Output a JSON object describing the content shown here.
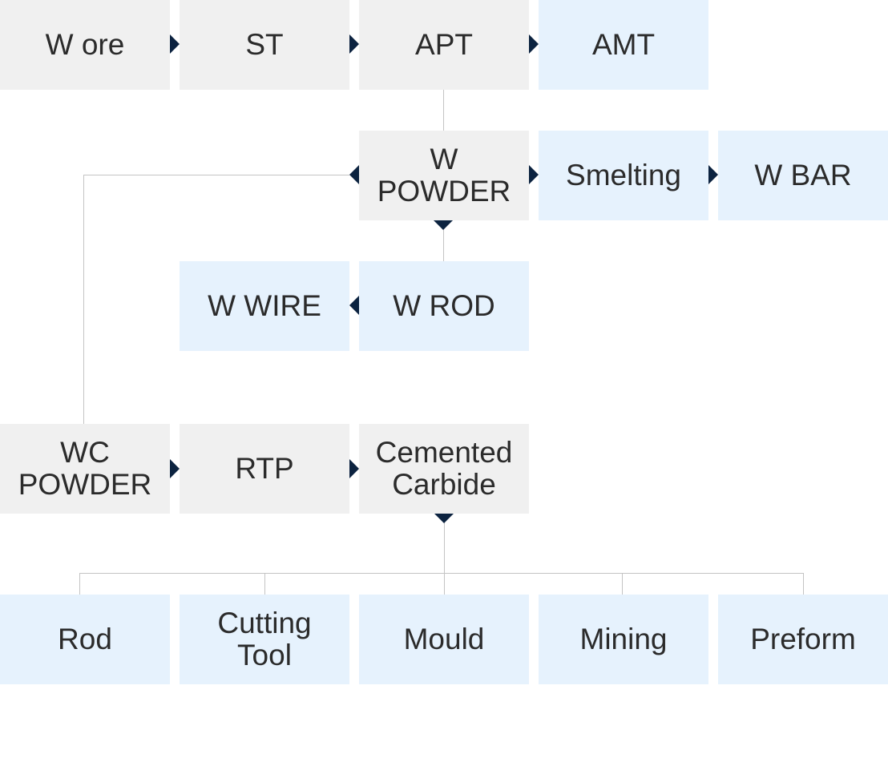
{
  "colors": {
    "process": "#f0f0f0",
    "product": "#e6f2fd",
    "arrow": "#0c2340",
    "line": "#c4c4c4"
  },
  "nodes": {
    "w_ore": "W ore",
    "st": "ST",
    "apt": "APT",
    "amt": "AMT",
    "w_powder": "W\nPOWDER",
    "smelting": "Smelting",
    "w_bar": "W BAR",
    "w_wire": "W WIRE",
    "w_rod": "W ROD",
    "wc_powder": "WC\nPOWDER",
    "rtp": "RTP",
    "cemented_carbide": "Cemented\nCarbide",
    "rod": "Rod",
    "cutting_tool": "Cutting\nTool",
    "mould": "Mould",
    "mining": "Mining",
    "preform": "Preform"
  }
}
